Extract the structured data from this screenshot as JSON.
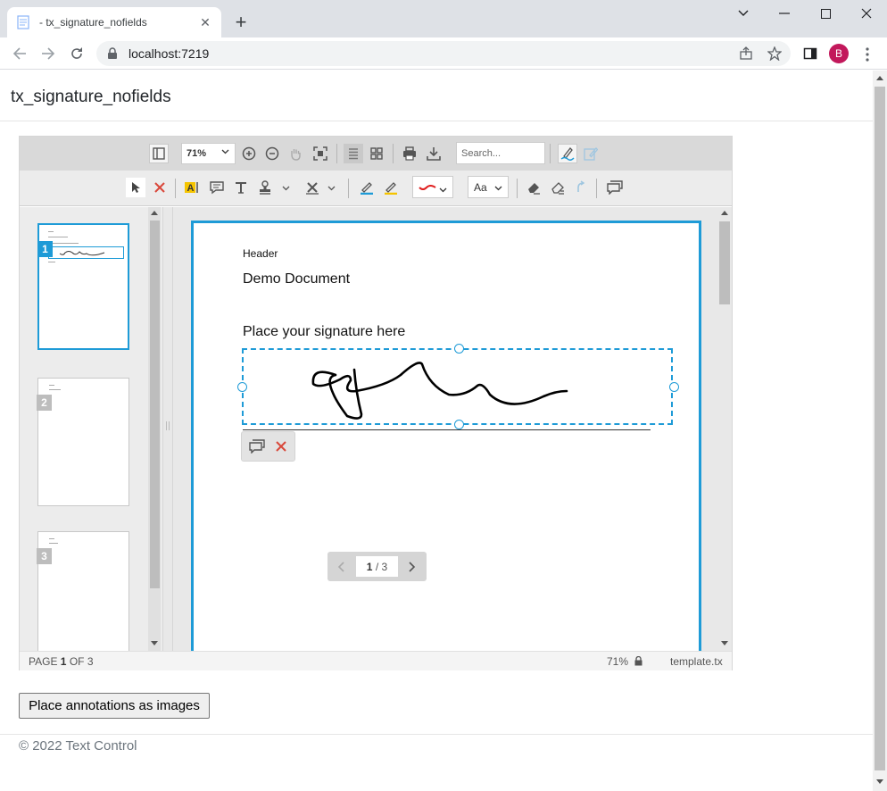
{
  "browser": {
    "tab_title": "- tx_signature_nofields",
    "url": "localhost:7219",
    "profile_initial": "B"
  },
  "page": {
    "title": "tx_signature_nofields",
    "place_button": "Place annotations as images",
    "footer": "© 2022 Text Control"
  },
  "viewer": {
    "zoom": "71%",
    "search_placeholder": "Search...",
    "font_button": "Aa",
    "thumbnails": [
      "1",
      "2",
      "3"
    ],
    "document": {
      "header": "Header",
      "title": "Demo Document",
      "prompt": "Place your signature here"
    },
    "pager": {
      "current": "1",
      "separator": " / ",
      "total": "3"
    },
    "status": {
      "page_prefix": "PAGE ",
      "page_current": "1",
      "page_suffix": " OF 3",
      "zoom": "71%",
      "file": "template.tx"
    }
  },
  "colors": {
    "accent": "#1e9bd7",
    "delete_red": "#d9483b",
    "signature_red": "#e02020",
    "highlight_yellow": "#f5c400",
    "avatar": "#c2185b"
  }
}
